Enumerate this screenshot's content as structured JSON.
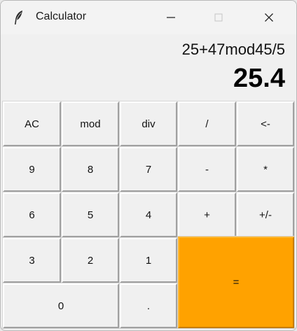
{
  "window": {
    "title": "Calculator"
  },
  "display": {
    "expression": "25+47mod45/5",
    "result": "25.4"
  },
  "keys": {
    "ac": "AC",
    "mod": "mod",
    "div": "div",
    "divide": "/",
    "backspace": "<-",
    "nine": "9",
    "eight": "8",
    "seven": "7",
    "minus": "-",
    "multiply": "*",
    "six": "6",
    "five": "5",
    "four": "4",
    "plus": "+",
    "sign": "+/-",
    "three": "3",
    "two": "2",
    "one": "1",
    "equals": "=",
    "zero": "0",
    "decimal": "."
  },
  "colors": {
    "equals_key": "#ffa200",
    "key_background": "#f0f0f0"
  },
  "icons": {
    "app": "feather-icon",
    "minimize": "minimize-icon",
    "maximize": "maximize-icon",
    "close": "close-icon"
  }
}
